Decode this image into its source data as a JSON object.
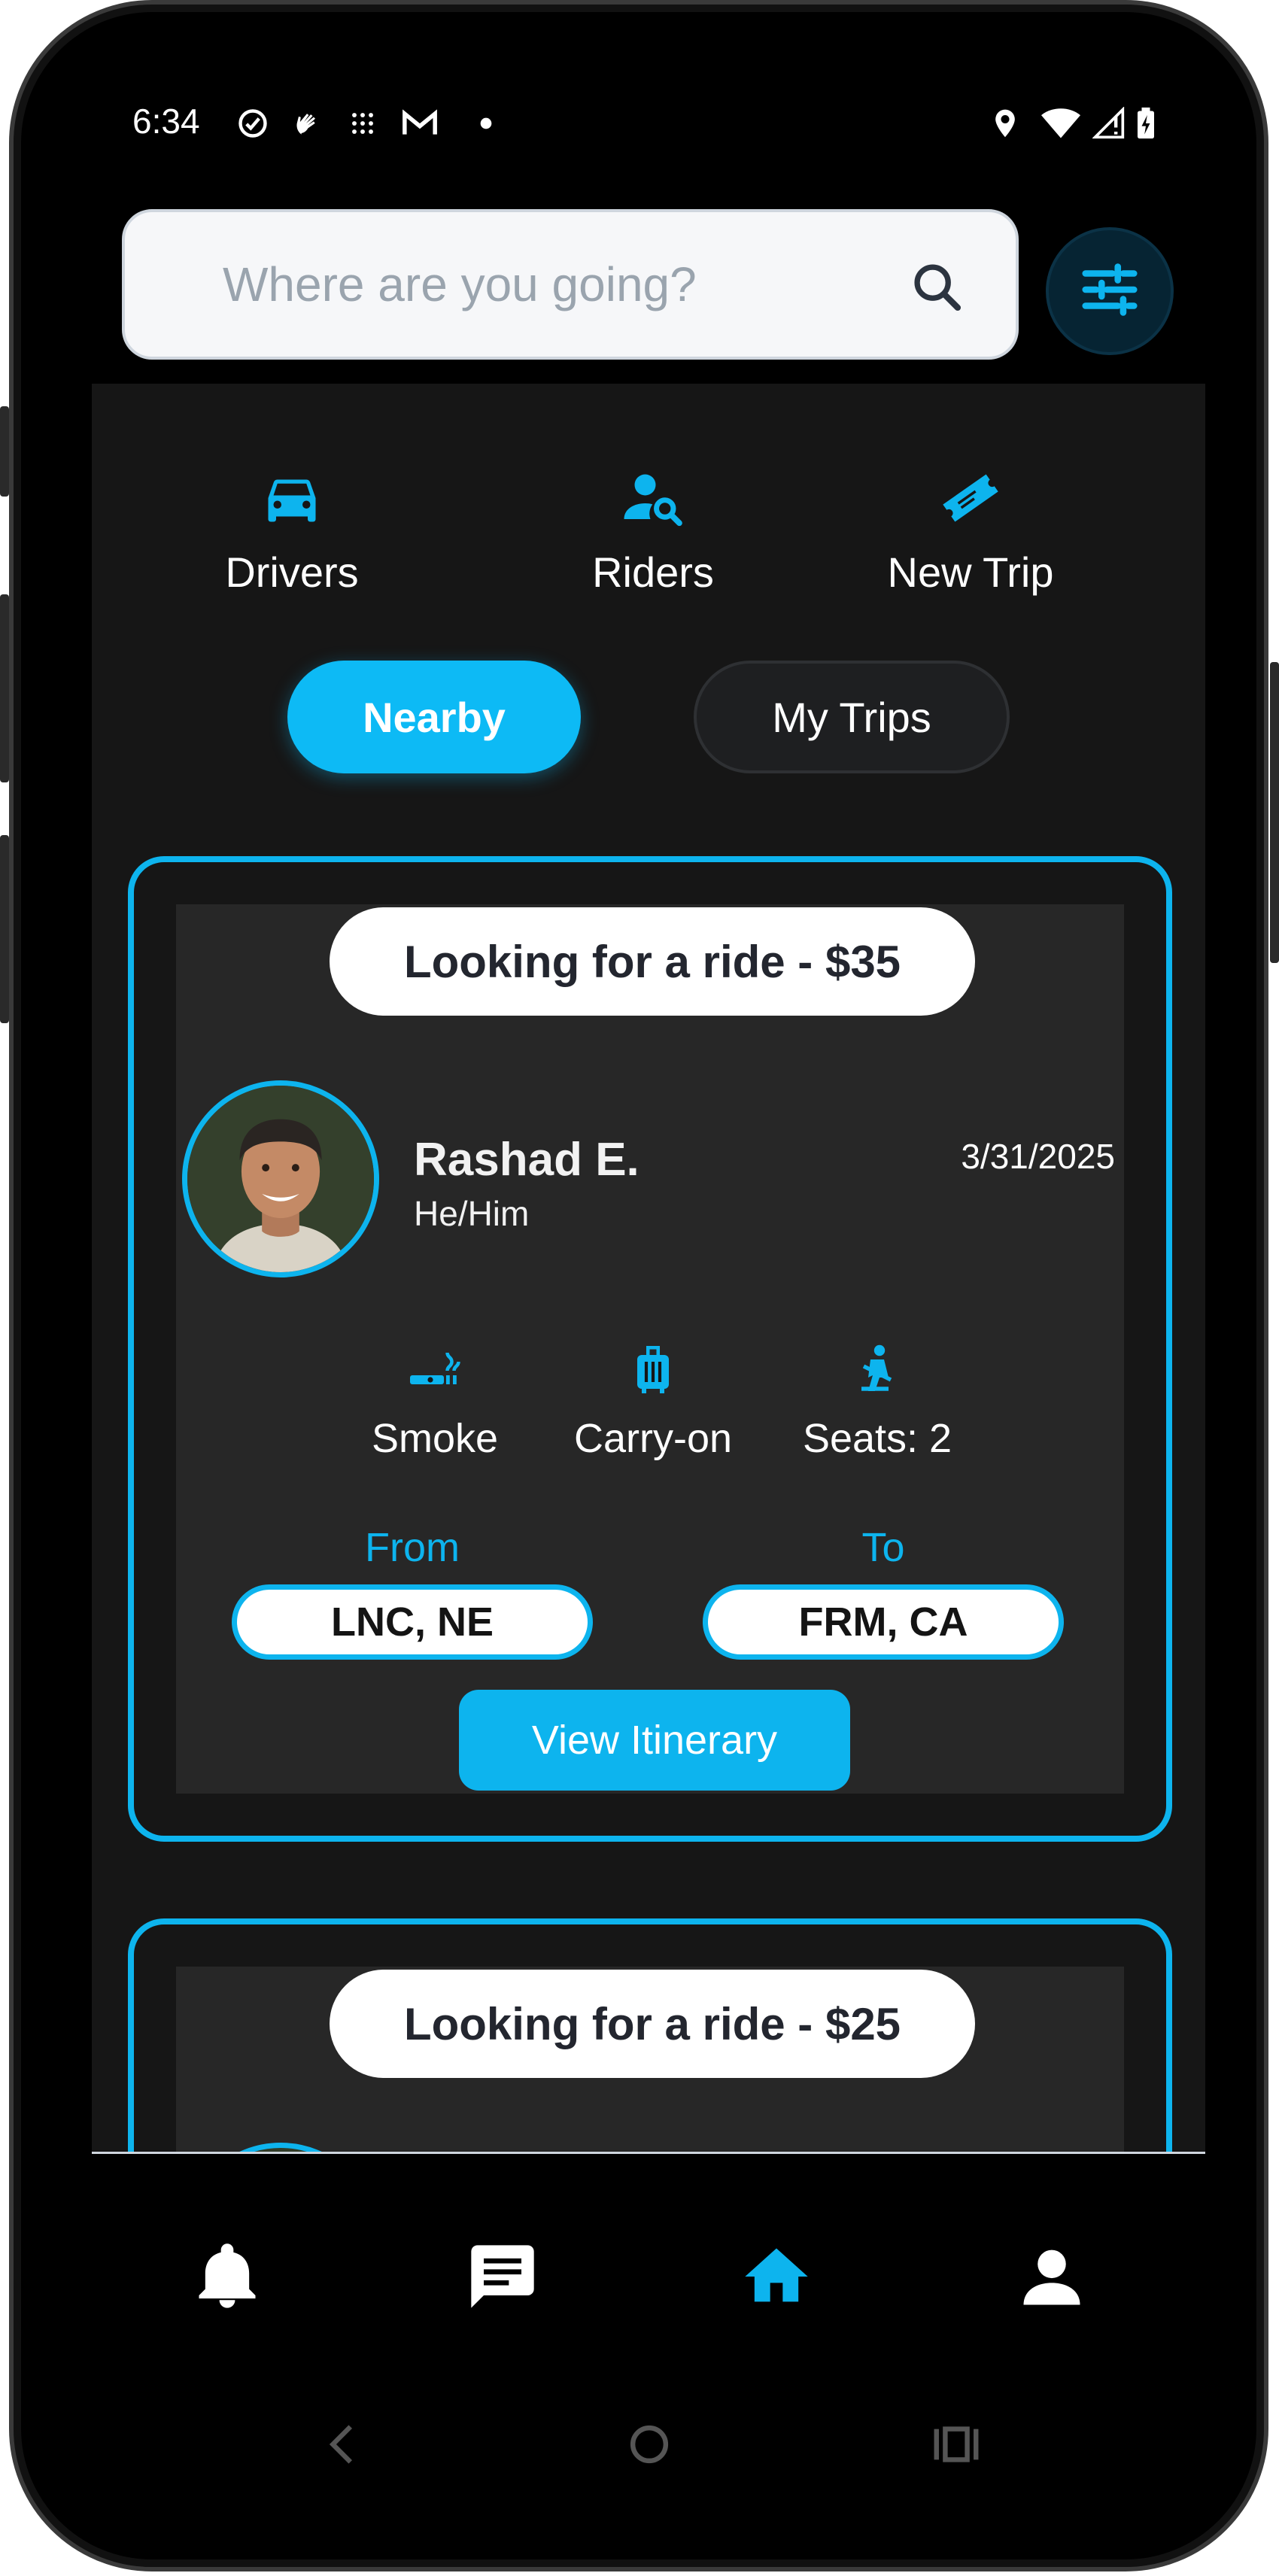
{
  "status_bar": {
    "time": "6:34"
  },
  "search": {
    "placeholder": "Where are you going?"
  },
  "quick_actions": [
    {
      "label": "Drivers",
      "icon": "car-icon"
    },
    {
      "label": "Riders",
      "icon": "rider-search-icon"
    },
    {
      "label": "New Trip",
      "icon": "ticket-icon"
    }
  ],
  "tabs": [
    {
      "label": "Nearby",
      "active": true
    },
    {
      "label": "My Trips",
      "active": false
    }
  ],
  "cards": [
    {
      "headline": "Looking for a ride - $35",
      "name": "Rashad E.",
      "pronouns": "He/Him",
      "date": "3/31/2025",
      "features": [
        {
          "label": "Smoke",
          "icon": "smoking-icon"
        },
        {
          "label": "Carry-on",
          "icon": "luggage-icon"
        },
        {
          "label": "Seats: 2",
          "icon": "seatbelt-icon"
        }
      ],
      "from_label": "From",
      "from": "LNC, NE",
      "to_label": "To",
      "to": "FRM, CA",
      "button": "View Itinerary"
    },
    {
      "headline": "Looking for a ride - $25"
    }
  ],
  "bottom_nav": [
    {
      "icon": "bell-icon",
      "active": false
    },
    {
      "icon": "chat-icon",
      "active": false
    },
    {
      "icon": "home-icon",
      "active": true
    },
    {
      "icon": "profile-icon",
      "active": false
    }
  ],
  "colors": {
    "accent": "#0DB4EE",
    "background": "#000000",
    "panel": "#161616",
    "card_inner": "#272727"
  }
}
